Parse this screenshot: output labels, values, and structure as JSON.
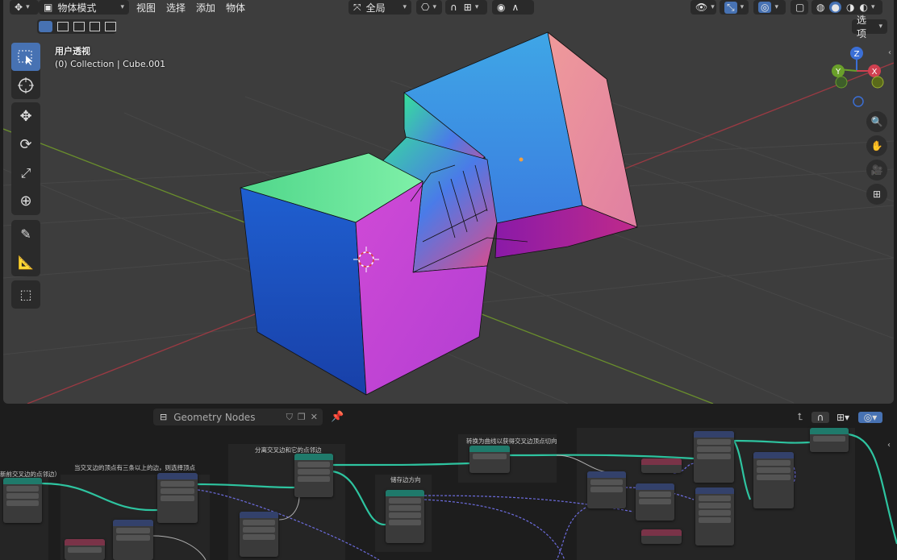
{
  "viewport_header": {
    "mode_label": "物体模式",
    "menus": [
      "视图",
      "选择",
      "添加",
      "物体"
    ],
    "transform_orientation": "全局",
    "options_label": "选项"
  },
  "viewport": {
    "view_name": "用户透视",
    "collection_info": "(0) Collection | Cube.001",
    "gizmo": {
      "z": "Z",
      "y": "Y",
      "x": "X"
    }
  },
  "toolbar_tools": [
    "select-box",
    "cursor",
    "move",
    "rotate",
    "scale",
    "transform",
    "annotate",
    "measure",
    "add-cube"
  ],
  "node_editor": {
    "tree_name": "Geometry Nodes",
    "frames": [
      "新前交叉边的点邻边）",
      "当交叉边的顶点有三条以上的边，则选择顶点",
      "分离交叉边和它的点邻边",
      "储存边方向",
      "转换为曲线以获得交叉边顶点切向"
    ]
  },
  "colors": {
    "accent": "#4772b3",
    "grid_x_axis": "#9c3a43",
    "grid_y_axis": "#6a8f2c",
    "node_green": "#1f7a6b",
    "node_blue": "#33416b",
    "node_red": "#7a3348",
    "link_geometry": "#2ec4a0",
    "link_vector": "#6d6de0"
  }
}
